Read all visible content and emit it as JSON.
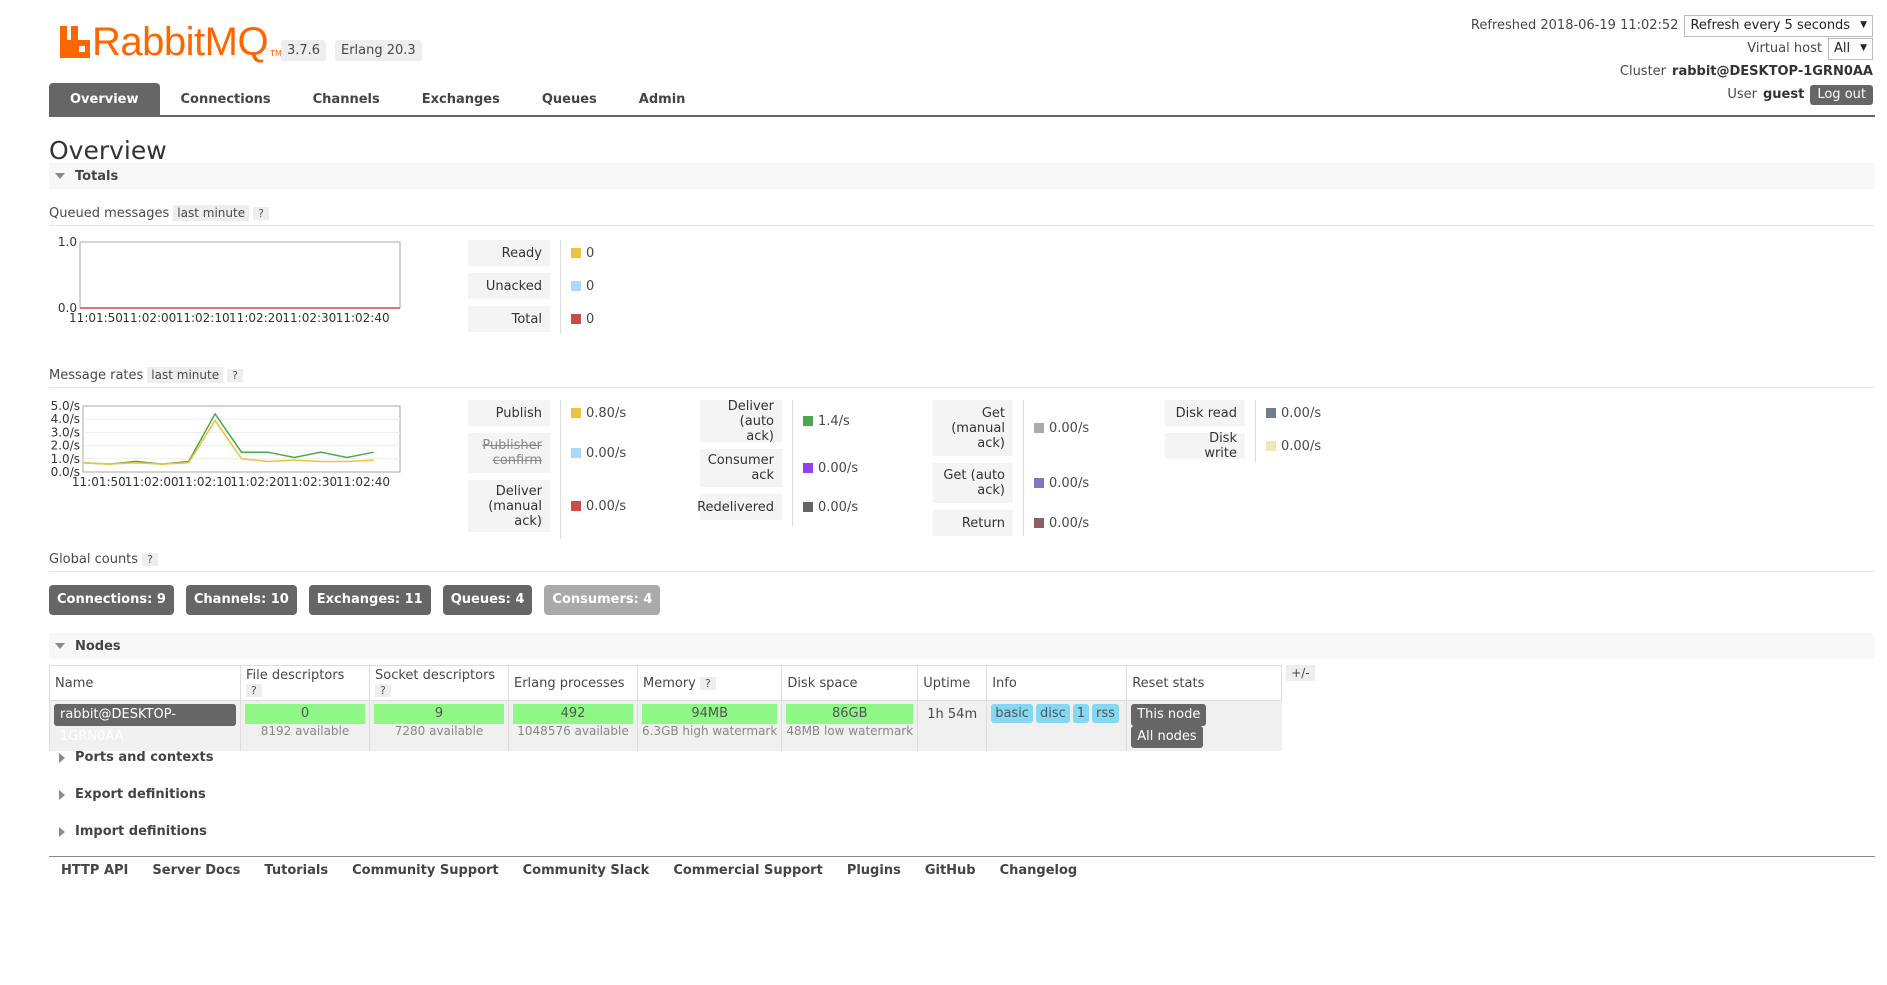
{
  "header": {
    "logo_text": "RabbitMQ",
    "logo_tm": "TM",
    "version": "3.7.6",
    "erlang": "Erlang 20.3",
    "refreshed_label": "Refreshed 2018-06-19 11:02:52",
    "refresh_select": "Refresh every 5 seconds",
    "vhost_label": "Virtual host",
    "vhost_value": "All",
    "cluster_label": "Cluster",
    "cluster_value": "rabbit@DESKTOP-1GRN0AA",
    "user_label": "User",
    "user_value": "guest",
    "logout": "Log out"
  },
  "tabs": [
    "Overview",
    "Connections",
    "Channels",
    "Exchanges",
    "Queues",
    "Admin"
  ],
  "page_title": "Overview",
  "totals": {
    "section": "Totals",
    "queued_label": "Queued messages",
    "queued_range": "last minute",
    "help": "?",
    "queued_legend": [
      {
        "label": "Ready",
        "value": "0",
        "color": "#edc240"
      },
      {
        "label": "Unacked",
        "value": "0",
        "color": "#afd8f8"
      },
      {
        "label": "Total",
        "value": "0",
        "color": "#cb4b4b"
      }
    ],
    "rates_label": "Message rates",
    "rates_range": "last minute",
    "rates_col1": [
      {
        "label": "Publish",
        "value": "0.80/s",
        "color": "#edc240"
      },
      {
        "label": "Publisher confirm",
        "value": "0.00/s",
        "color": "#afd8f8"
      },
      {
        "label": "Deliver (manual ack)",
        "value": "0.00/s",
        "color": "#cb4b4b"
      }
    ],
    "rates_col2": [
      {
        "label": "Deliver (auto ack)",
        "value": "1.4/s",
        "color": "#4da74d"
      },
      {
        "label": "Consumer ack",
        "value": "0.00/s",
        "color": "#9440ed"
      },
      {
        "label": "Redelivered",
        "value": "0.00/s",
        "color": "#666666"
      }
    ],
    "rates_col3": [
      {
        "label": "Get (manual ack)",
        "value": "0.00/s",
        "color": "#aaaaaa"
      },
      {
        "label": "Get (auto ack)",
        "value": "0.00/s",
        "color": "#7c79c3"
      },
      {
        "label": "Return",
        "value": "0.00/s",
        "color": "#8d6161"
      }
    ],
    "rates_col4": [
      {
        "label": "Disk read",
        "value": "0.00/s",
        "color": "#6f7f8a"
      },
      {
        "label": "Disk write",
        "value": "0.00/s",
        "color": "#ede9b4"
      }
    ],
    "global_label": "Global counts",
    "global_counts": [
      "Connections: 9",
      "Channels: 10",
      "Exchanges: 11",
      "Queues: 4",
      "Consumers: 4"
    ]
  },
  "chart_data": [
    {
      "type": "line",
      "title": "Queued messages",
      "x": [
        "11:01:50",
        "11:02:00",
        "11:02:10",
        "11:02:20",
        "11:02:30",
        "11:02:40"
      ],
      "ylim": [
        0,
        1
      ],
      "y_ticks": [
        "0.0",
        "1.0"
      ],
      "series": [
        {
          "name": "Total",
          "values": [
            0,
            0,
            0,
            0,
            0,
            0
          ],
          "color": "#cb4b4b"
        }
      ]
    },
    {
      "type": "line",
      "title": "Message rates",
      "x": [
        "11:01:50",
        "11:02:00",
        "11:02:10",
        "11:02:20",
        "11:02:30",
        "11:02:40"
      ],
      "ylim": [
        0,
        5
      ],
      "y_ticks": [
        "0.0/s",
        "1.0/s",
        "2.0/s",
        "3.0/s",
        "4.0/s",
        "5.0/s"
      ],
      "series": [
        {
          "name": "Deliver (auto ack)",
          "color": "#4da74d",
          "t": [
            0,
            5,
            10,
            15,
            20,
            25,
            30,
            35,
            40,
            45,
            50,
            55
          ],
          "values": [
            0.7,
            0.6,
            0.8,
            0.6,
            0.8,
            4.4,
            1.5,
            1.5,
            1.1,
            1.5,
            1.1,
            1.5
          ]
        },
        {
          "name": "Publish",
          "color": "#edc240",
          "t": [
            0,
            5,
            10,
            15,
            20,
            25,
            30,
            35,
            40,
            45,
            50,
            55
          ],
          "values": [
            0.7,
            0.6,
            0.7,
            0.6,
            0.7,
            3.9,
            1.0,
            0.8,
            0.9,
            0.8,
            0.8,
            0.9
          ]
        }
      ]
    }
  ],
  "nodes": {
    "section": "Nodes",
    "columns": [
      "Name",
      "File descriptors",
      "Socket descriptors",
      "Erlang processes",
      "Memory",
      "Disk space",
      "Uptime",
      "Info",
      "Reset stats"
    ],
    "plusminus": "+/-",
    "row": {
      "name": "rabbit@DESKTOP-1GRN0AA",
      "fd": "0",
      "fd_sub": "8192 available",
      "sd": "9",
      "sd_sub": "7280 available",
      "ep": "492",
      "ep_sub": "1048576 available",
      "mem": "94MB",
      "mem_sub": "6.3GB high watermark",
      "disk": "86GB",
      "disk_sub": "48MB low watermark",
      "uptime": "1h 54m",
      "info": [
        "basic",
        "disc",
        "1",
        "rss"
      ],
      "reset_this": "This node",
      "reset_all": "All nodes"
    }
  },
  "collapsed_sections": [
    "Ports and contexts",
    "Export definitions",
    "Import definitions"
  ],
  "footer": [
    "HTTP API",
    "Server Docs",
    "Tutorials",
    "Community Support",
    "Community Slack",
    "Commercial Support",
    "Plugins",
    "GitHub",
    "Changelog"
  ]
}
